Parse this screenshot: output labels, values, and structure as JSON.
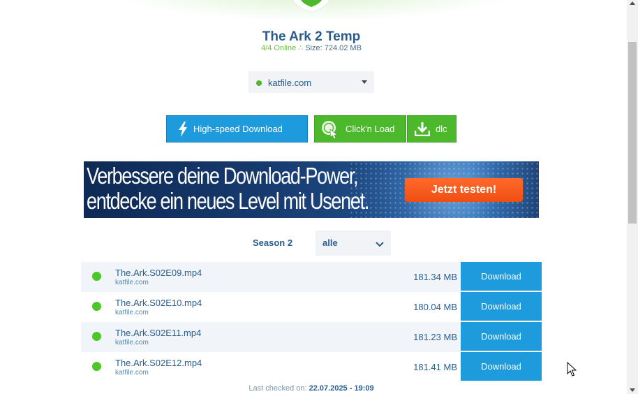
{
  "header": {
    "title": "The Ark 2 Temp",
    "online_status": "4/4 Online",
    "separator": "∴",
    "size_text": "Size: 724.02 MB"
  },
  "hoster": {
    "selected": "katfile.com",
    "status_color": "#4cb82c"
  },
  "actions": {
    "highspeed_label": "High-speed Download",
    "clicknload_label": "Click'n Load",
    "dlc_label": "dlc"
  },
  "banner": {
    "line1": "Verbessere deine Download-Power,",
    "line2": "entdecke ein neues Level mit Usenet.",
    "cta": "Jetzt testen!"
  },
  "season": {
    "label": "Season 2",
    "selected": "alle"
  },
  "files": [
    {
      "name": "The.Ark.S02E09.mp4",
      "host": "katfile.com",
      "size": "181.34 MB",
      "button": "Download"
    },
    {
      "name": "The.Ark.S02E10.mp4",
      "host": "katfile.com",
      "size": "180.04 MB",
      "button": "Download"
    },
    {
      "name": "The.Ark.S02E11.mp4",
      "host": "katfile.com",
      "size": "181.23 MB",
      "button": "Download"
    },
    {
      "name": "The.Ark.S02E12.mp4",
      "host": "katfile.com",
      "size": "181.41 MB",
      "button": "Download"
    }
  ],
  "footer": {
    "last_checked_label": "Last checked on:",
    "last_checked_value": "22.07.2025 - 19:09"
  },
  "colors": {
    "primary_blue": "#1d9bdc",
    "green": "#4cb82c",
    "text_blue": "#2a5d8c",
    "cta_orange": "#f04e12"
  }
}
